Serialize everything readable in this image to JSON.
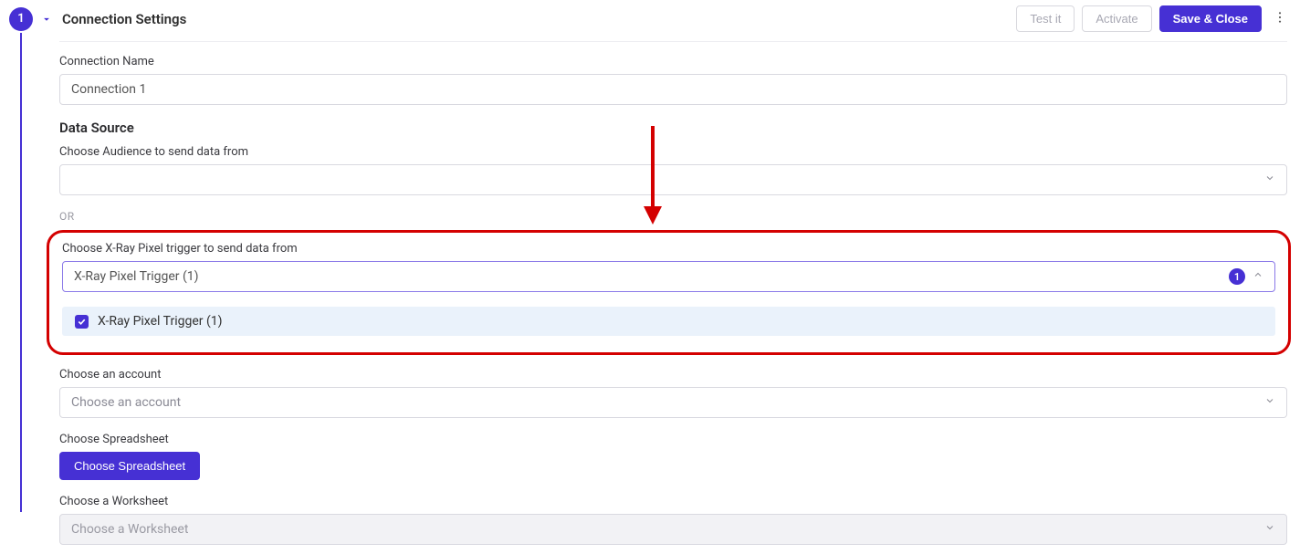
{
  "header": {
    "step_number": "1",
    "title": "Connection Settings",
    "buttons": {
      "test": "Test it",
      "activate": "Activate",
      "save_close": "Save & Close"
    }
  },
  "fields": {
    "connection_name": {
      "label": "Connection Name",
      "value": "Connection 1"
    },
    "data_source_section": "Data Source",
    "audience": {
      "label": "Choose Audience to send data from",
      "value": ""
    },
    "or_text": "OR",
    "xray": {
      "label": "Choose X-Ray Pixel trigger to send data from",
      "selected_display": "X-Ray Pixel Trigger (1)",
      "count_badge": "1",
      "options": [
        {
          "label": "X-Ray Pixel Trigger (1)",
          "checked": true
        }
      ]
    },
    "account": {
      "label": "Choose an account",
      "placeholder": "Choose an account"
    },
    "spreadsheet": {
      "label": "Choose Spreadsheet",
      "button": "Choose Spreadsheet"
    },
    "worksheet": {
      "label": "Choose a Worksheet",
      "placeholder": "Choose a Worksheet"
    }
  }
}
